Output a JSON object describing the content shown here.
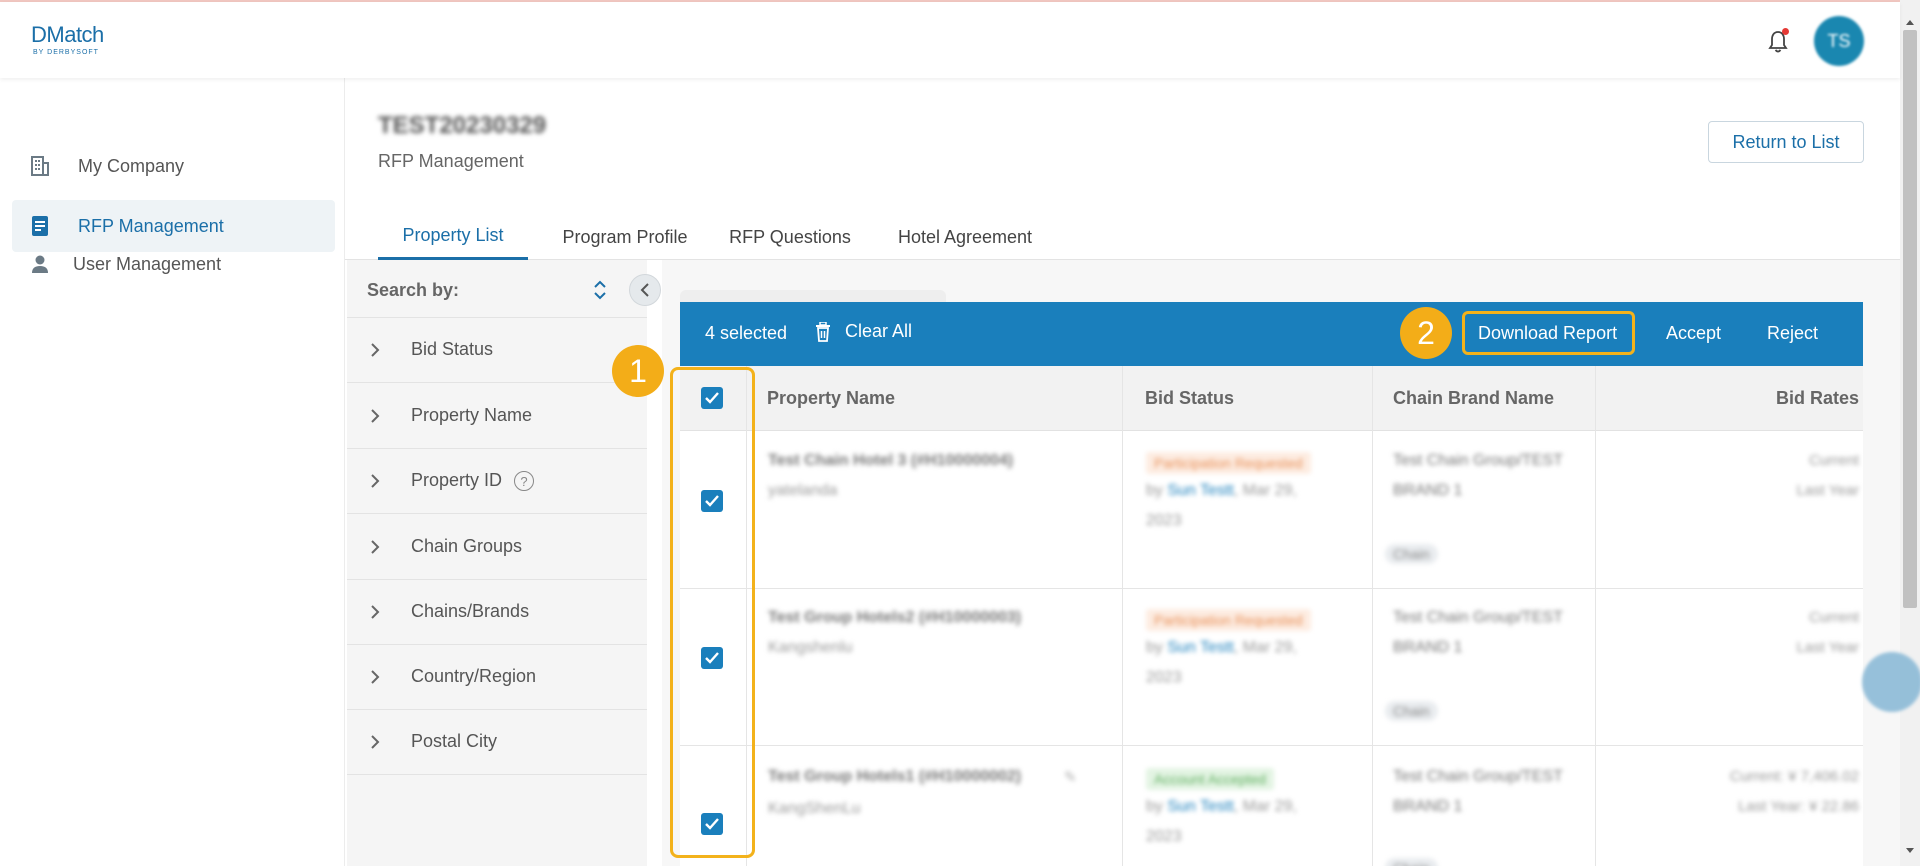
{
  "app": {
    "logo_text": "DMatch",
    "logo_subtext": "BY DERBYSOFT",
    "avatar_initials": "TS"
  },
  "sidebar": {
    "items": [
      {
        "label": "My Company",
        "icon": "building-icon",
        "active": false
      },
      {
        "label": "RFP Management",
        "icon": "document-icon",
        "active": true
      },
      {
        "label": "User Management",
        "icon": "user-icon",
        "active": false
      }
    ]
  },
  "header": {
    "title": "TEST20230329",
    "subtitle": "RFP Management",
    "return_button": "Return to List"
  },
  "tabs": [
    {
      "label": "Property List",
      "active": true
    },
    {
      "label": "Program Profile",
      "active": false
    },
    {
      "label": "RFP Questions",
      "active": false
    },
    {
      "label": "Hotel Agreement",
      "active": false
    }
  ],
  "filters": {
    "search_by_label": "Search by:",
    "items": [
      "Bid Status",
      "Property Name",
      "Property ID",
      "Chain Groups",
      "Chains/Brands",
      "Country/Region",
      "Postal City"
    ]
  },
  "selection_bar": {
    "count_text": "4 selected",
    "clear_all": "Clear All",
    "download_report": "Download Report",
    "accept": "Accept",
    "reject": "Reject"
  },
  "table": {
    "columns": [
      "Property Name",
      "Bid Status",
      "Chain Brand Name",
      "Bid Rates"
    ],
    "rows": [
      {
        "checked": true,
        "property_name": "Test Chain Hotel 3 (#H10000004)",
        "property_sub": "yatelanda",
        "status": "Participation Requested",
        "status_kind": "requested",
        "status_by_prefix": "by ",
        "status_by_name": "Sun Testt",
        "status_by_date": ", Mar 29, 2023",
        "chain": "Test Chain Group/TEST BRAND 1",
        "chain_badge": "Chain",
        "rate_line1": "Current",
        "rate_line2": "Last Year"
      },
      {
        "checked": true,
        "property_name": "Test Group Hotels2 (#H10000003)",
        "property_sub": "Kangshenlu",
        "status": "Participation Requested",
        "status_kind": "requested",
        "status_by_prefix": "by ",
        "status_by_name": "Sun Testt",
        "status_by_date": ", Mar 29, 2023",
        "chain": "Test Chain Group/TEST BRAND 1",
        "chain_badge": "Chain",
        "rate_line1": "Current",
        "rate_line2": "Last Year"
      },
      {
        "checked": true,
        "property_name": "Test Group Hotels1 (#H10000002)",
        "property_sub": "KangShenLu",
        "status": "Account Accepted",
        "status_kind": "accepted",
        "status_by_prefix": "by ",
        "status_by_name": "Sun Testt",
        "status_by_date": ", Mar 29, 2023",
        "chain": "Test Chain Group/TEST BRAND 1",
        "chain_badge": "Chain",
        "rate_line1": "Current: ¥ 7,406.02",
        "rate_line2": "Last Year: ¥ 22.86"
      }
    ]
  },
  "annotations": {
    "step1": "1",
    "step2": "2"
  },
  "colors": {
    "brand": "#1b6fa8",
    "selection_bar": "#1a7fbc",
    "highlight": "#f3b21b",
    "requested_bg": "#fdece1",
    "requested_fg": "#e8915a",
    "accepted_bg": "#e3f4e3",
    "accepted_fg": "#5fae5f"
  }
}
